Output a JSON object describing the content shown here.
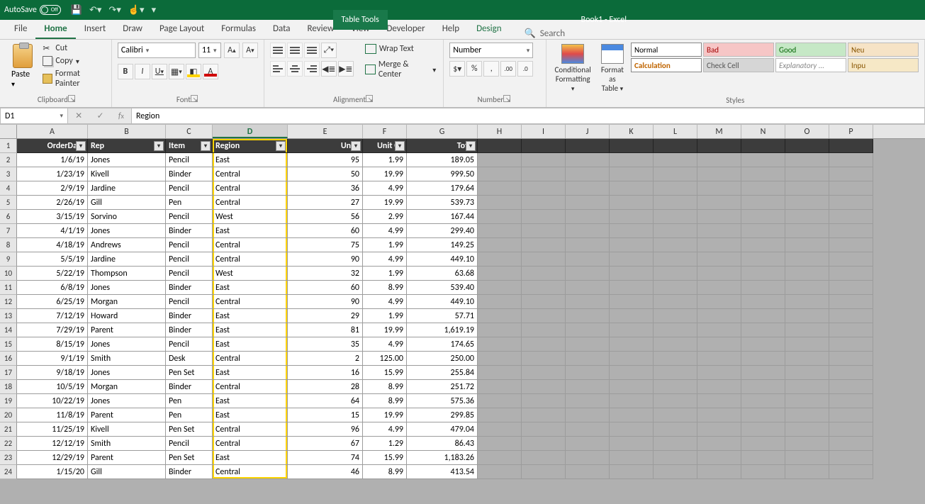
{
  "titlebar": {
    "autosave_label": "AutoSave",
    "autosave_state": "Off",
    "tool_tab": "Table Tools",
    "doc_title": "Book1 - Excel"
  },
  "tabs": [
    "File",
    "Home",
    "Insert",
    "Draw",
    "Page Layout",
    "Formulas",
    "Data",
    "Review",
    "View",
    "Developer",
    "Help",
    "Design"
  ],
  "active_tab": "Home",
  "search_label": "Search",
  "clipboard": {
    "paste": "Paste",
    "cut": "Cut",
    "copy": "Copy",
    "painter": "Format Painter",
    "group": "Clipboard"
  },
  "font": {
    "name": "Calibri",
    "size": "11",
    "group": "Font"
  },
  "alignment": {
    "wrap": "Wrap Text",
    "merge": "Merge & Center",
    "group": "Alignment"
  },
  "number": {
    "format": "Number",
    "group": "Number"
  },
  "styles": {
    "cond": "Conditional Formatting",
    "fmttab": "Format as Table",
    "gallery": {
      "normal": "Normal",
      "bad": "Bad",
      "good": "Good",
      "neutral": "Neu",
      "calc": "Calculation",
      "check": "Check Cell",
      "explan": "Explanatory ...",
      "input": "Inpu"
    },
    "group": "Styles"
  },
  "namebox": "D1",
  "formula": "Region",
  "columns": [
    "A",
    "B",
    "C",
    "D",
    "E",
    "F",
    "G",
    "H",
    "I",
    "J",
    "K",
    "L",
    "M",
    "N",
    "O",
    "P"
  ],
  "headers": {
    "a": "OrderDate",
    "b": "Rep",
    "c": "Item",
    "d": "Region",
    "e": "Units",
    "f": "Unit Co",
    "g": "Total"
  },
  "rows": [
    {
      "n": 2,
      "a": "1/6/19",
      "b": "Jones",
      "c": "Pencil",
      "d": "East",
      "e": "95",
      "f": "1.99",
      "g": "189.05"
    },
    {
      "n": 3,
      "a": "1/23/19",
      "b": "Kivell",
      "c": "Binder",
      "d": "Central",
      "e": "50",
      "f": "19.99",
      "g": "999.50"
    },
    {
      "n": 4,
      "a": "2/9/19",
      "b": "Jardine",
      "c": "Pencil",
      "d": "Central",
      "e": "36",
      "f": "4.99",
      "g": "179.64"
    },
    {
      "n": 5,
      "a": "2/26/19",
      "b": "Gill",
      "c": "Pen",
      "d": "Central",
      "e": "27",
      "f": "19.99",
      "g": "539.73"
    },
    {
      "n": 6,
      "a": "3/15/19",
      "b": "Sorvino",
      "c": "Pencil",
      "d": "West",
      "e": "56",
      "f": "2.99",
      "g": "167.44"
    },
    {
      "n": 7,
      "a": "4/1/19",
      "b": "Jones",
      "c": "Binder",
      "d": "East",
      "e": "60",
      "f": "4.99",
      "g": "299.40"
    },
    {
      "n": 8,
      "a": "4/18/19",
      "b": "Andrews",
      "c": "Pencil",
      "d": "Central",
      "e": "75",
      "f": "1.99",
      "g": "149.25"
    },
    {
      "n": 9,
      "a": "5/5/19",
      "b": "Jardine",
      "c": "Pencil",
      "d": "Central",
      "e": "90",
      "f": "4.99",
      "g": "449.10"
    },
    {
      "n": 10,
      "a": "5/22/19",
      "b": "Thompson",
      "c": "Pencil",
      "d": "West",
      "e": "32",
      "f": "1.99",
      "g": "63.68"
    },
    {
      "n": 11,
      "a": "6/8/19",
      "b": "Jones",
      "c": "Binder",
      "d": "East",
      "e": "60",
      "f": "8.99",
      "g": "539.40"
    },
    {
      "n": 12,
      "a": "6/25/19",
      "b": "Morgan",
      "c": "Pencil",
      "d": "Central",
      "e": "90",
      "f": "4.99",
      "g": "449.10"
    },
    {
      "n": 13,
      "a": "7/12/19",
      "b": "Howard",
      "c": "Binder",
      "d": "East",
      "e": "29",
      "f": "1.99",
      "g": "57.71"
    },
    {
      "n": 14,
      "a": "7/29/19",
      "b": "Parent",
      "c": "Binder",
      "d": "East",
      "e": "81",
      "f": "19.99",
      "g": "1,619.19"
    },
    {
      "n": 15,
      "a": "8/15/19",
      "b": "Jones",
      "c": "Pencil",
      "d": "East",
      "e": "35",
      "f": "4.99",
      "g": "174.65"
    },
    {
      "n": 16,
      "a": "9/1/19",
      "b": "Smith",
      "c": "Desk",
      "d": "Central",
      "e": "2",
      "f": "125.00",
      "g": "250.00"
    },
    {
      "n": 17,
      "a": "9/18/19",
      "b": "Jones",
      "c": "Pen Set",
      "d": "East",
      "e": "16",
      "f": "15.99",
      "g": "255.84"
    },
    {
      "n": 18,
      "a": "10/5/19",
      "b": "Morgan",
      "c": "Binder",
      "d": "Central",
      "e": "28",
      "f": "8.99",
      "g": "251.72"
    },
    {
      "n": 19,
      "a": "10/22/19",
      "b": "Jones",
      "c": "Pen",
      "d": "East",
      "e": "64",
      "f": "8.99",
      "g": "575.36"
    },
    {
      "n": 20,
      "a": "11/8/19",
      "b": "Parent",
      "c": "Pen",
      "d": "East",
      "e": "15",
      "f": "19.99",
      "g": "299.85"
    },
    {
      "n": 21,
      "a": "11/25/19",
      "b": "Kivell",
      "c": "Pen Set",
      "d": "Central",
      "e": "96",
      "f": "4.99",
      "g": "479.04"
    },
    {
      "n": 22,
      "a": "12/12/19",
      "b": "Smith",
      "c": "Pencil",
      "d": "Central",
      "e": "67",
      "f": "1.29",
      "g": "86.43"
    },
    {
      "n": 23,
      "a": "12/29/19",
      "b": "Parent",
      "c": "Pen Set",
      "d": "East",
      "e": "74",
      "f": "15.99",
      "g": "1,183.26"
    },
    {
      "n": 24,
      "a": "1/15/20",
      "b": "Gill",
      "c": "Binder",
      "d": "Central",
      "e": "46",
      "f": "8.99",
      "g": "413.54"
    }
  ]
}
